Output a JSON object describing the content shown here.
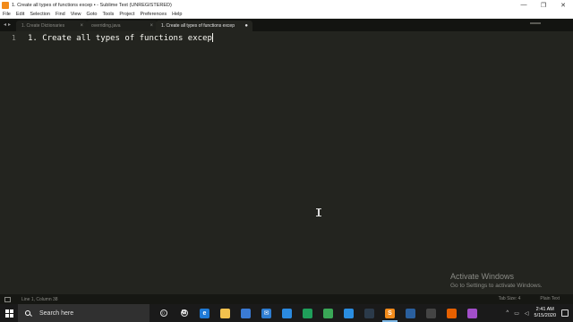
{
  "window": {
    "title": "1. Create all types of functions excep • - Sublime Text (UNREGISTERED)",
    "controls": {
      "minimize": "—",
      "maximize": "❐",
      "close": "✕"
    }
  },
  "menu": [
    "File",
    "Edit",
    "Selection",
    "Find",
    "View",
    "Goto",
    "Tools",
    "Project",
    "Preferences",
    "Help"
  ],
  "tabs": [
    {
      "label": "1. Create Dictionaries",
      "close": "×",
      "active": false
    },
    {
      "label": "overriding.java",
      "close": "×",
      "active": false
    },
    {
      "label": "1. Create all types of functions excep",
      "close": "●",
      "active": true
    }
  ],
  "tab_nav": {
    "prev": "◂",
    "next": "▸"
  },
  "editor": {
    "line_number": "1",
    "code": "1. Create all types of functions excep"
  },
  "watermark": {
    "title": "Activate Windows",
    "subtitle": "Go to Settings to activate Windows."
  },
  "statusbar": {
    "position": "Line 1, Column 38",
    "tab_size": "Tab Size: 4",
    "syntax": "Plain Text"
  },
  "taskbar": {
    "search_placeholder": "Search here",
    "apps": [
      {
        "name": "cortana-icon",
        "glyph": "○",
        "color": "#1a1a1a"
      },
      {
        "name": "task-view-icon",
        "glyph": "⧉",
        "color": "#1a1a1a"
      },
      {
        "name": "edge-icon",
        "glyph": "e",
        "color": "#1f7ad6"
      },
      {
        "name": "file-explorer-icon",
        "glyph": "",
        "color": "#f2c14e"
      },
      {
        "name": "store-icon",
        "glyph": "",
        "color": "#3a7bd5"
      },
      {
        "name": "mail-icon",
        "glyph": "✉",
        "color": "#2e7dd1"
      },
      {
        "name": "app-blue-icon",
        "glyph": "",
        "color": "#2b8ae0"
      },
      {
        "name": "app-green-icon",
        "glyph": "",
        "color": "#1f9e5a"
      },
      {
        "name": "app-chrome-icon",
        "glyph": "",
        "color": "#3aa757"
      },
      {
        "name": "vscode-icon",
        "glyph": "",
        "color": "#2a8de0"
      },
      {
        "name": "terminal-icon",
        "glyph": "",
        "color": "#2b3a4a"
      },
      {
        "name": "sublime-icon",
        "glyph": "S",
        "color": "#f28b1b"
      },
      {
        "name": "powershell-icon",
        "glyph": "",
        "color": "#2a5f9e"
      },
      {
        "name": "app-dots-icon",
        "glyph": "",
        "color": "#444"
      },
      {
        "name": "firefox-icon",
        "glyph": "",
        "color": "#e66000"
      },
      {
        "name": "app-purple-icon",
        "glyph": "",
        "color": "#a24ec9"
      }
    ],
    "tray": {
      "chevron": "^",
      "time": "2:41 AM",
      "date": "5/15/2020"
    }
  },
  "colors": {
    "editor_bg": "#23241f",
    "code_text": "#f8f8f2",
    "tabbar_bg": "#131411",
    "taskbar_bg": "#1a1a1a",
    "sublime_orange": "#f28b1b"
  }
}
